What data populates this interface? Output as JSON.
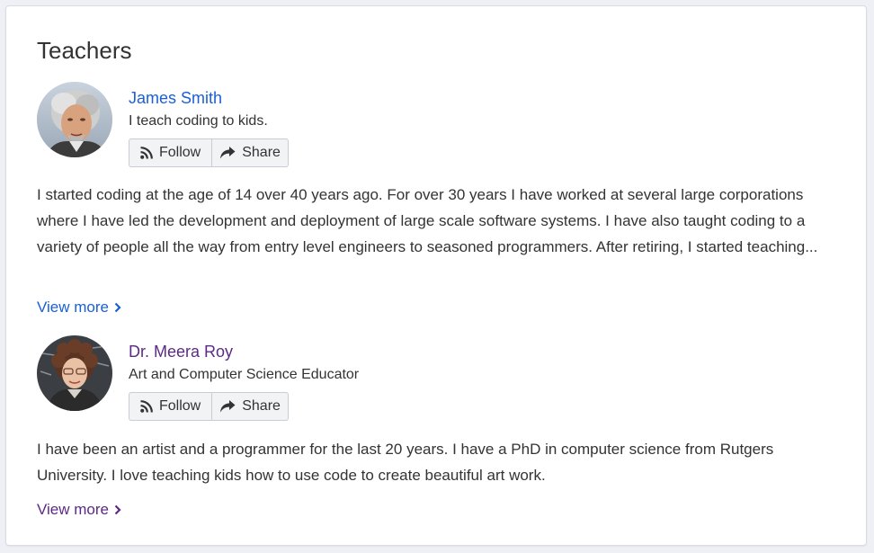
{
  "section": {
    "title": "Teachers"
  },
  "teachers": [
    {
      "name": "James Smith",
      "tagline": "I teach coding to kids.",
      "follow_label": "Follow",
      "share_label": "Share",
      "bio": "I started coding at the age of 14 over 40 years ago. For over 30 years I have worked at several large corporations where I have led the development and deployment of large scale software systems. I have also taught coding to a variety of people all the way from entry level engineers to seasoned programmers.  After retiring, I started teaching...",
      "view_more_label": "View more",
      "name_color": "#1a5fd8"
    },
    {
      "name": "Dr. Meera Roy",
      "tagline": "Art and Computer Science Educator",
      "follow_label": "Follow",
      "share_label": "Share",
      "bio": "I have been an artist and a programmer for the last 20 years. I have a PhD in computer science from Rutgers University. I love teaching kids how to use code to create beautiful art work.",
      "view_more_label": "View more",
      "name_color": "#5c2a86"
    }
  ],
  "icons": {
    "follow": "rss-icon",
    "share": "share-arrow-icon",
    "view_more": "chevron-right-icon"
  }
}
